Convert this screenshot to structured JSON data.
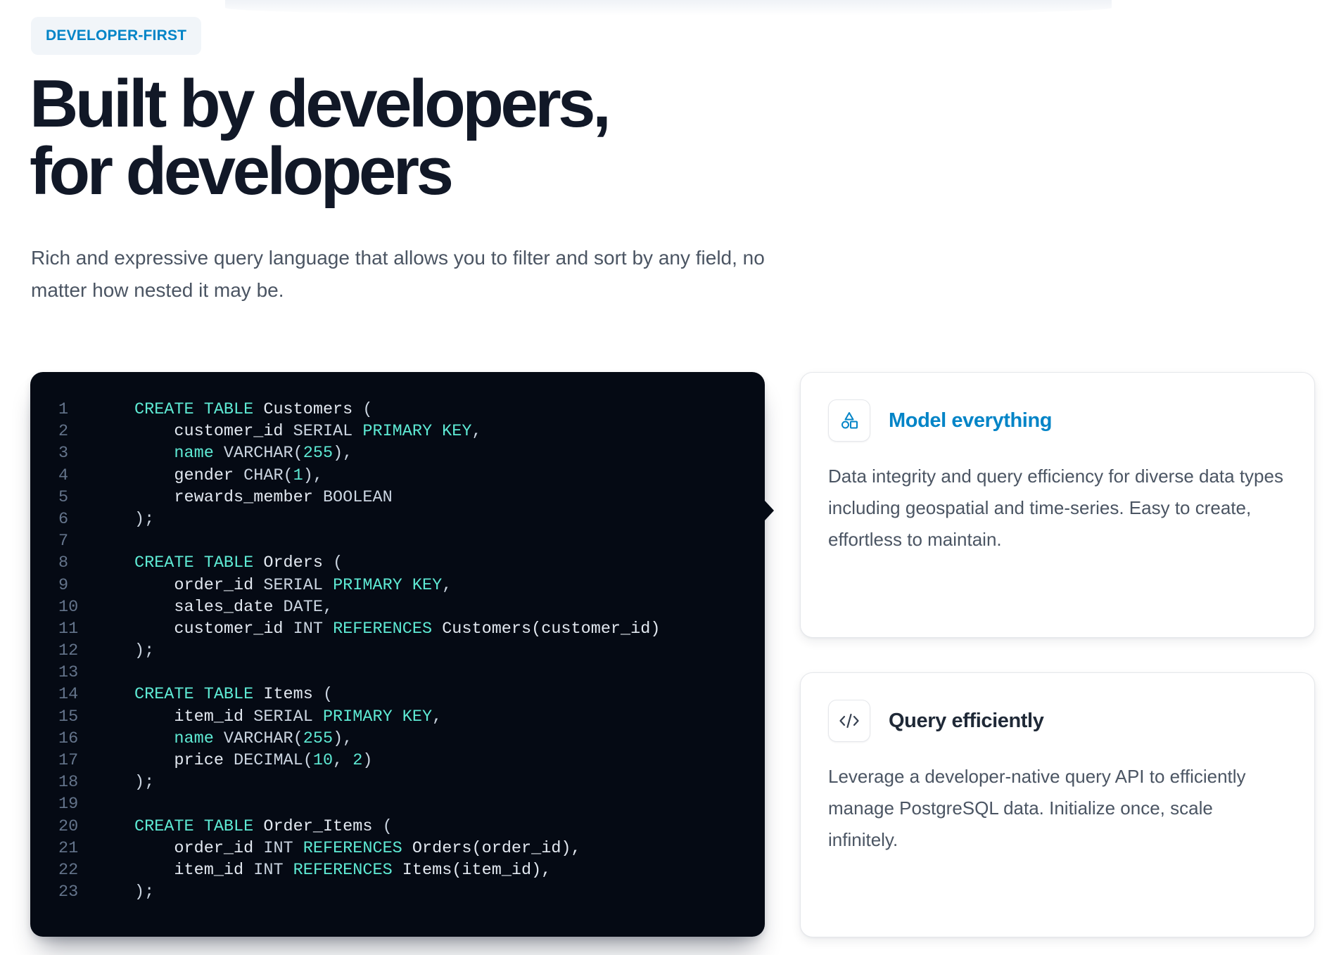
{
  "eyebrow": "DEVELOPER-FIRST",
  "headline": {
    "line1": "Built by developers,",
    "line2": "for developers"
  },
  "lede": "Rich and expressive query language that allows you to filter and sort by any field, no matter how nested it may be.",
  "code": {
    "lines": [
      {
        "n": "1",
        "tokens": [
          [
            "kw",
            "CREATE TABLE"
          ],
          [
            "id",
            " Customers "
          ],
          [
            "p",
            "("
          ]
        ]
      },
      {
        "n": "2",
        "tokens": [
          [
            "id",
            "    customer_id "
          ],
          [
            "type",
            "SERIAL "
          ],
          [
            "kw",
            "PRIMARY KEY"
          ],
          [
            "p",
            ","
          ]
        ]
      },
      {
        "n": "3",
        "tokens": [
          [
            "kw",
            "    name "
          ],
          [
            "type",
            "VARCHAR("
          ],
          [
            "num",
            "255"
          ],
          [
            "p",
            "),"
          ]
        ]
      },
      {
        "n": "4",
        "tokens": [
          [
            "id",
            "    gender "
          ],
          [
            "type",
            "CHAR("
          ],
          [
            "num",
            "1"
          ],
          [
            "p",
            "),"
          ]
        ]
      },
      {
        "n": "5",
        "tokens": [
          [
            "id",
            "    rewards_member "
          ],
          [
            "type",
            "BOOLEAN"
          ]
        ]
      },
      {
        "n": "6",
        "tokens": [
          [
            "p",
            ");"
          ]
        ]
      },
      {
        "n": "7",
        "tokens": []
      },
      {
        "n": "8",
        "tokens": [
          [
            "kw",
            "CREATE TABLE"
          ],
          [
            "id",
            " Orders "
          ],
          [
            "p",
            "("
          ]
        ]
      },
      {
        "n": "9",
        "tokens": [
          [
            "id",
            "    order_id "
          ],
          [
            "type",
            "SERIAL "
          ],
          [
            "kw",
            "PRIMARY KEY"
          ],
          [
            "p",
            ","
          ]
        ]
      },
      {
        "n": "10",
        "tokens": [
          [
            "id",
            "    sales_date "
          ],
          [
            "type",
            "DATE"
          ],
          [
            "p",
            ","
          ]
        ]
      },
      {
        "n": "11",
        "tokens": [
          [
            "id",
            "    customer_id "
          ],
          [
            "type",
            "INT "
          ],
          [
            "kw",
            "REFERENCES"
          ],
          [
            "id",
            " Customers(customer_id)"
          ]
        ]
      },
      {
        "n": "12",
        "tokens": [
          [
            "p",
            ");"
          ]
        ]
      },
      {
        "n": "13",
        "tokens": []
      },
      {
        "n": "14",
        "tokens": [
          [
            "kw",
            "CREATE TABLE"
          ],
          [
            "id",
            " Items "
          ],
          [
            "p",
            "("
          ]
        ]
      },
      {
        "n": "15",
        "tokens": [
          [
            "id",
            "    item_id "
          ],
          [
            "type",
            "SERIAL "
          ],
          [
            "kw",
            "PRIMARY KEY"
          ],
          [
            "p",
            ","
          ]
        ]
      },
      {
        "n": "16",
        "tokens": [
          [
            "kw",
            "    name "
          ],
          [
            "type",
            "VARCHAR("
          ],
          [
            "num",
            "255"
          ],
          [
            "p",
            "),"
          ]
        ]
      },
      {
        "n": "17",
        "tokens": [
          [
            "id",
            "    price "
          ],
          [
            "type",
            "DECIMAL("
          ],
          [
            "num",
            "10"
          ],
          [
            "p",
            ", "
          ],
          [
            "num",
            "2"
          ],
          [
            "p",
            ")"
          ]
        ]
      },
      {
        "n": "18",
        "tokens": [
          [
            "p",
            ");"
          ]
        ]
      },
      {
        "n": "19",
        "tokens": []
      },
      {
        "n": "20",
        "tokens": [
          [
            "kw",
            "CREATE TABLE"
          ],
          [
            "id",
            " Order_Items "
          ],
          [
            "p",
            "("
          ]
        ]
      },
      {
        "n": "21",
        "tokens": [
          [
            "id",
            "    order_id "
          ],
          [
            "type",
            "INT "
          ],
          [
            "kw",
            "REFERENCES"
          ],
          [
            "id",
            " Orders(order_id),"
          ]
        ]
      },
      {
        "n": "22",
        "tokens": [
          [
            "id",
            "    item_id "
          ],
          [
            "type",
            "INT "
          ],
          [
            "kw",
            "REFERENCES"
          ],
          [
            "id",
            " Items(item_id),"
          ]
        ]
      },
      {
        "n": "23",
        "tokens": [
          [
            "p",
            ");"
          ]
        ]
      }
    ]
  },
  "features": {
    "model": {
      "icon": "shapes-icon",
      "title": "Model everything",
      "body": "Data integrity and query efficiency for diverse data types including geospatial and time-series. Easy to create, effortless to maintain."
    },
    "query": {
      "icon": "code-icon",
      "title": "Query efficiently",
      "body": "Leverage a developer-native query API to efficiently manage PostgreSQL data. Initialize once, scale infinitely."
    }
  },
  "colors": {
    "accent": "#0284c7",
    "heading": "#111827",
    "body": "#4b5563",
    "code_bg": "#050a14",
    "code_keyword": "#5eead4",
    "code_text": "#cbd5e1",
    "line_number": "#64748b"
  }
}
